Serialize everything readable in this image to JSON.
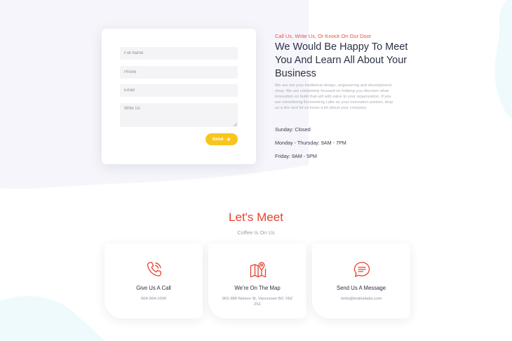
{
  "contact_form": {
    "full_name_placeholder": "Full Name",
    "phone_placeholder": "Phone",
    "email_placeholder": "Email",
    "message_placeholder": "Write Us",
    "send_label": "Send"
  },
  "contact_info": {
    "eyebrow": "Call Us, Write Us, Or Knock On Our Door",
    "title": "We Would Be Happy To Meet You And Learn All About Your Business",
    "description": "We are not your traditional design, engineering and development shop. We are completely focused on helping you discover what innovation so build that will add value to your organization. If you are considering Envisioning Labs as your innovation partner, drop us a line and let us know a bit about your company.",
    "hours": [
      "Sunday: Closed",
      "Monday - Thursday: 9AM - 7PM",
      "Friday: 9AM - 5PM"
    ]
  },
  "meet": {
    "title": "Let's Meet",
    "subtitle": "Coffee Is On Us",
    "cards": [
      {
        "icon": "phone-icon",
        "title": "Give Us A Call",
        "detail": "604-364-1009"
      },
      {
        "icon": "map-pin-icon",
        "title": "We're On The Map",
        "detail": "902-989 Nelson St, Vancouver BC V6Z 2S1"
      },
      {
        "icon": "chat-bubble-icon",
        "title": "Send Us A Message",
        "detail": "hello@krativelabs.com"
      }
    ]
  },
  "colors": {
    "accent_red": "#e8402f",
    "button_yellow": "#f7c51e",
    "blob_lavender": "#f4f4fb",
    "blob_cyan": "#effbfd"
  }
}
